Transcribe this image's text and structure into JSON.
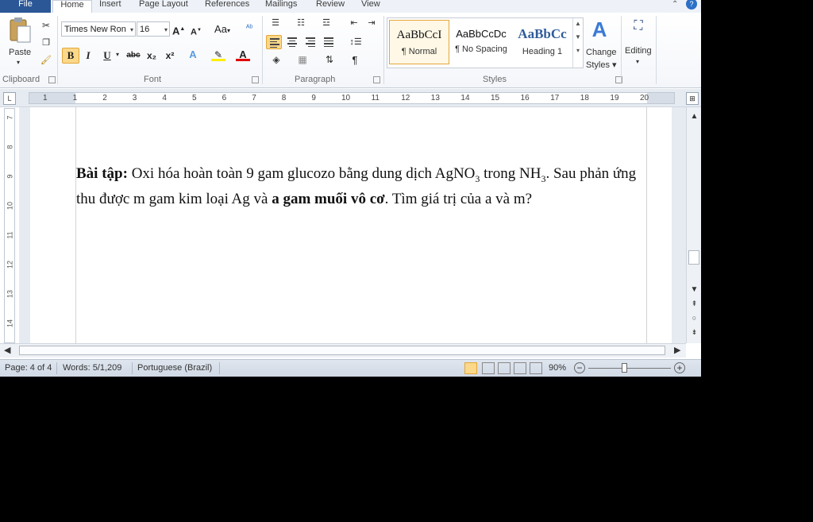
{
  "tabs": [
    "File",
    "Home",
    "Insert",
    "Page Layout",
    "References",
    "Mailings",
    "Review",
    "View"
  ],
  "clipboard": {
    "paste_label": "Paste",
    "group_label": "Clipboard"
  },
  "font": {
    "family": "Times New Ron",
    "size": "16",
    "grow": "A",
    "shrink": "A",
    "case": "Aa",
    "bold": "B",
    "italic": "I",
    "underline": "U",
    "strike": "abc",
    "sub": "x₂",
    "sup": "x²",
    "group_label": "Font"
  },
  "paragraph": {
    "group_label": "Paragraph",
    "pilcrow": "¶"
  },
  "styles": {
    "group_label": "Styles",
    "tiles": [
      {
        "sample": "AaBbCcI",
        "name": "¶ Normal"
      },
      {
        "sample": "AaBbCcDc",
        "name": "¶ No Spacing"
      },
      {
        "sample": "AaBbCc",
        "name": "Heading 1"
      }
    ],
    "change_styles": "Change Styles",
    "change_styles_line1": "Change",
    "change_styles_line2": "Styles"
  },
  "editing": {
    "label": "Editing"
  },
  "ruler": {
    "corner": "L",
    "labels": [
      "1",
      "1",
      "2",
      "3",
      "4",
      "5",
      "6",
      "7",
      "8",
      "9",
      "10",
      "11",
      "12",
      "13",
      "14",
      "15",
      "16",
      "17",
      "18",
      "19",
      "20"
    ],
    "vlabels": [
      "7",
      "8",
      "9",
      "10",
      "11",
      "12",
      "13",
      "14"
    ]
  },
  "document": {
    "heading": "Bài tập:",
    "text1": " Oxi hóa hoàn toàn 9 gam glucozo bằng dung dịch AgNO",
    "sub1": "3",
    "text2": " trong NH",
    "sub2": "3",
    "text3": ". Sau phản ứng thu được m gam kim loại Ag và ",
    "bold2": "a gam muối vô cơ",
    "text4": ". Tìm giá trị của a và m?"
  },
  "status": {
    "page": "Page: 4 of 4",
    "words": "Words: 5/1,209",
    "language": "Portuguese (Brazil)",
    "zoom": "90%",
    "zoom_fraction": 0.4
  }
}
